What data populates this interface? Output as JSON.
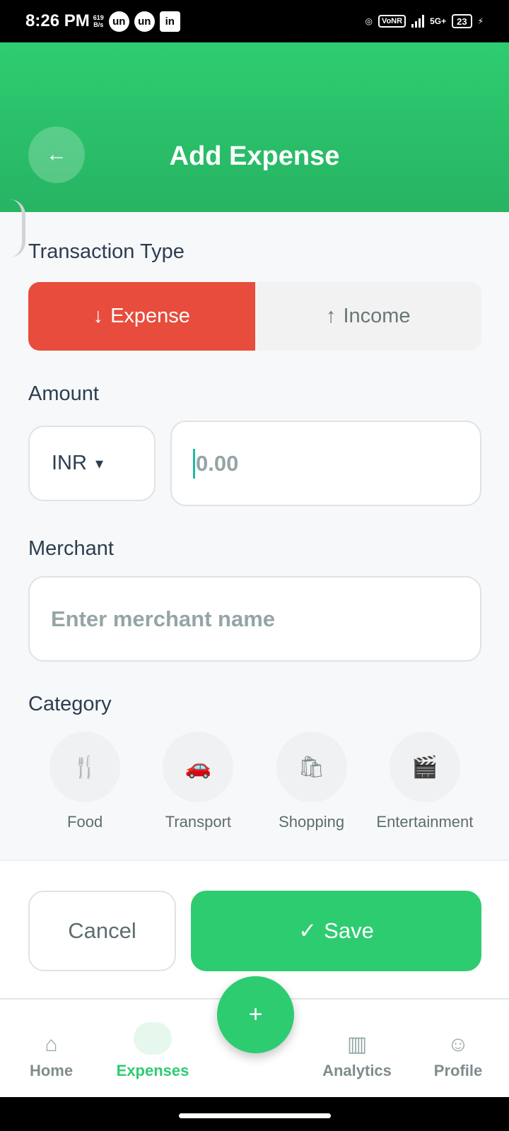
{
  "status_bar": {
    "time": "8:26 PM",
    "net_speed_value": "619",
    "net_speed_unit": "B/s",
    "apps": [
      "un",
      "un",
      "in"
    ],
    "vonr": "VoNR",
    "network": "5G+",
    "battery": "23"
  },
  "header": {
    "title": "Add Expense",
    "back_icon": "arrow-left-icon"
  },
  "form": {
    "transaction_type_label": "Transaction Type",
    "type_options": [
      {
        "label": "Expense",
        "icon": "arrow-down-icon",
        "active": true
      },
      {
        "label": "Income",
        "icon": "arrow-up-icon",
        "active": false
      }
    ],
    "amount_label": "Amount",
    "currency": "INR",
    "amount_placeholder": "0.00",
    "merchant_label": "Merchant",
    "merchant_placeholder": "Enter merchant name",
    "category_label": "Category",
    "categories": [
      {
        "label": "Food",
        "icon": "food-icon"
      },
      {
        "label": "Transport",
        "icon": "car-icon"
      },
      {
        "label": "Shopping",
        "icon": "shopping-icon"
      },
      {
        "label": "Entertainment",
        "icon": "entertainment-icon"
      }
    ]
  },
  "actions": {
    "cancel_label": "Cancel",
    "save_label": "Save"
  },
  "bottom_nav": {
    "items": [
      {
        "label": "Home",
        "active": false
      },
      {
        "label": "Expenses",
        "active": true
      },
      {
        "label": "Analytics",
        "active": false
      },
      {
        "label": "Profile",
        "active": false
      }
    ],
    "fab_icon": "plus-icon"
  },
  "colors": {
    "primary": "#2ecc71",
    "expense": "#e74c3c",
    "text": "#2c3e50"
  }
}
